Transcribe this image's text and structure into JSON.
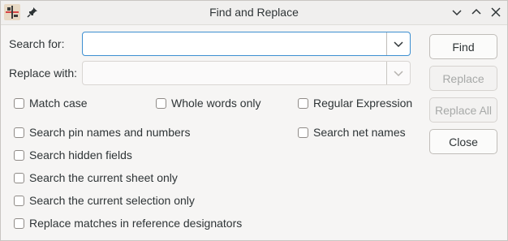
{
  "window": {
    "title": "Find and Replace"
  },
  "labels": {
    "search_for": "Search for:",
    "replace_with": "Replace with:"
  },
  "fields": {
    "search": {
      "value": "",
      "placeholder": ""
    },
    "replace": {
      "value": "",
      "placeholder": ""
    }
  },
  "buttons": {
    "find": "Find",
    "replace": "Replace",
    "replace_all": "Replace All",
    "close": "Close"
  },
  "options": {
    "match_case": "Match case",
    "whole_words": "Whole words only",
    "regex": "Regular Expression",
    "pin_names": "Search pin names and numbers",
    "net_names": "Search net names",
    "hidden_fields": "Search hidden fields",
    "current_sheet": "Search the current sheet only",
    "current_selection": "Search the current selection only",
    "ref_designators": "Replace matches in reference designators"
  },
  "icons": {
    "app": "kicad-eeschema-icon",
    "pin": "pin-icon",
    "minimize": "chevron-down-icon",
    "maximize": "chevron-up-icon",
    "close": "close-icon",
    "dropdown": "chevron-down-icon"
  },
  "colors": {
    "focus_border": "#3d8fd1",
    "disabled_text": "#a7a9a8",
    "app_accent": "#d64545"
  }
}
